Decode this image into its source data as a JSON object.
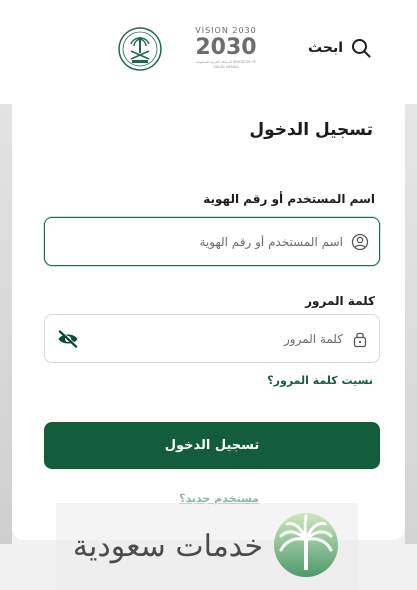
{
  "header": {
    "search_label": "ابحث",
    "vision_logo_text": "VISION 2030",
    "vision_arabic": "رؤيـــة",
    "vision_number": "2030",
    "vision_sub": "المملكة العربية السعودية KINGDOM OF SAUDI ARABIA"
  },
  "login": {
    "title": "تسجيل الدخول",
    "username_label": "اسم المستخدم أو رقم الهوية",
    "username_placeholder": "اسم المستخدم أو رقم الهوية",
    "password_label": "كلمة المرور",
    "password_placeholder": "كلمة المرور",
    "forgot_password": "نسيت كلمة المرور؟",
    "submit_label": "تسجيل الدخول",
    "new_user": "مستخدم جديد؟"
  },
  "watermark": {
    "text": "خدمات سعودية"
  },
  "colors": {
    "brand_green": "#135c3c",
    "link_green": "#1a5a3e",
    "muted_green": "#8fb7a2"
  }
}
